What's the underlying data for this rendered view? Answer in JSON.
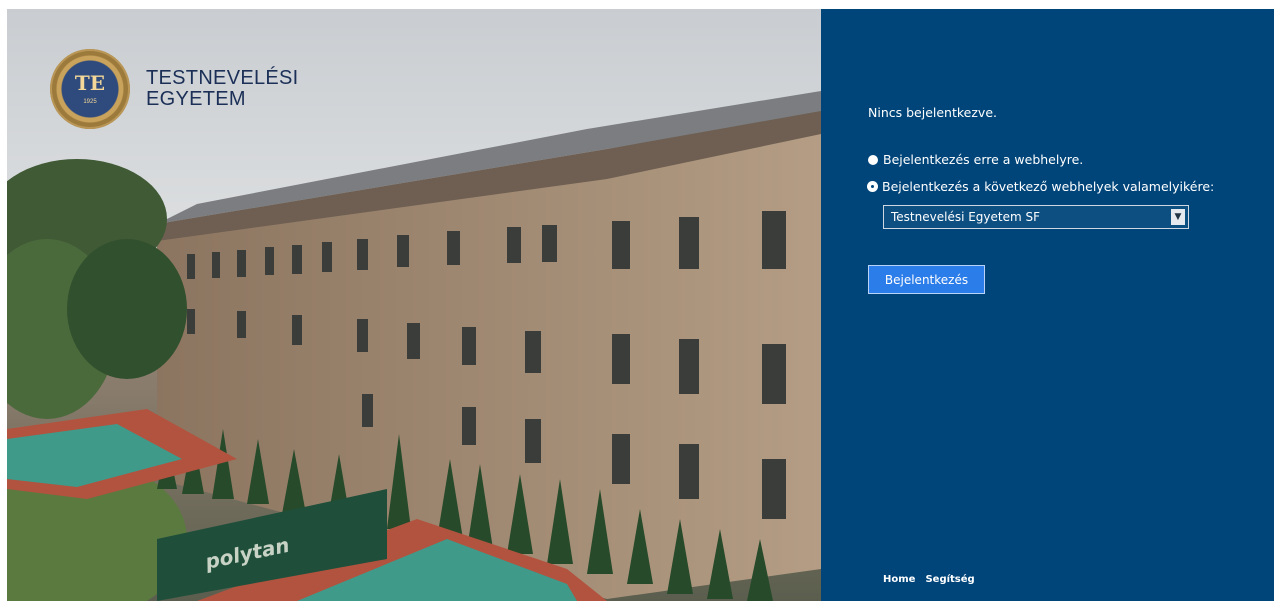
{
  "brand": {
    "seal_text": "TE",
    "seal_year": "1925",
    "name_line1": "TESTNEVELÉSI",
    "name_line2": "EGYETEM"
  },
  "hero": {
    "court_banner_text": "polytan"
  },
  "panel": {
    "status_text": "Nincs bejelentkezve.",
    "options": [
      {
        "label": "Bejelentkezés erre a webhelyre.",
        "selected": false
      },
      {
        "label": "Bejelentkezés a következő webhelyek valamelyikére:",
        "selected": true
      }
    ],
    "site_select": {
      "value": "Testnevelési Egyetem SF"
    },
    "login_button": "Bejelentkezés",
    "footer_links": [
      "Home",
      "Segítség"
    ]
  },
  "colors": {
    "panel_bg": "#00457a",
    "button_bg": "#2b7de9"
  }
}
